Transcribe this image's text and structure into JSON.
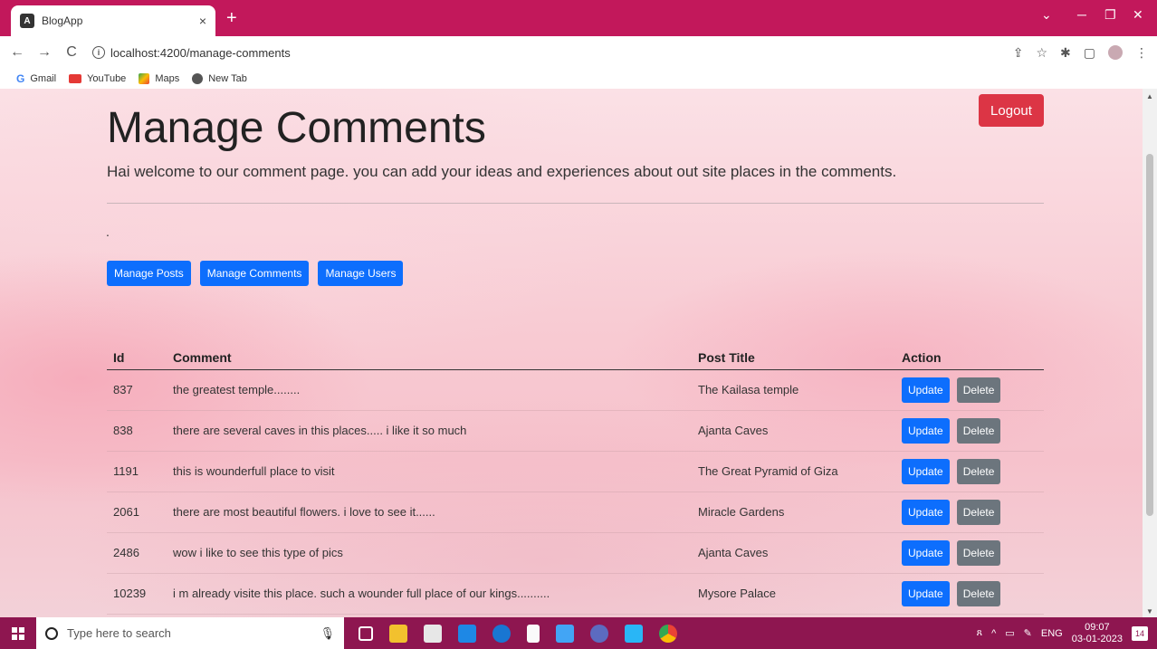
{
  "browser": {
    "tab_title": "BlogApp",
    "tab_icon_letter": "A",
    "tab_close": "×",
    "new_tab": "+",
    "url": "localhost:4200/manage-comments",
    "bookmarks": [
      "Gmail",
      "YouTube",
      "Maps",
      "New Tab"
    ],
    "bookmark_g": "G"
  },
  "page": {
    "title": "Manage Comments",
    "lead": "Hai welcome to our comment page. you can add your ideas and experiences about out site places in the comments.",
    "dot": ".",
    "logout_label": "Logout",
    "nav_buttons": [
      "Manage Posts",
      "Manage Comments",
      "Manage Users"
    ]
  },
  "table": {
    "headers": [
      "Id",
      "Comment",
      "Post Title",
      "Action"
    ],
    "update_label": "Update",
    "delete_label": "Delete",
    "rows": [
      {
        "id": "837",
        "comment": "the greatest temple........",
        "post": "The Kailasa temple"
      },
      {
        "id": "838",
        "comment": "there are several caves in this places..... i like it so much",
        "post": "Ajanta Caves"
      },
      {
        "id": "1191",
        "comment": "this is wounderfull place to visit",
        "post": "The Great Pyramid of Giza"
      },
      {
        "id": "2061",
        "comment": "there are most beautiful flowers. i love to see it......",
        "post": "Miracle Gardens"
      },
      {
        "id": "2486",
        "comment": "wow i like to see this type of pics",
        "post": "Ajanta Caves"
      },
      {
        "id": "10239",
        "comment": "i m already visite this place. such a wounder full place of our kings..........",
        "post": "Mysore Palace"
      }
    ]
  },
  "taskbar": {
    "search_placeholder": "Type here to search",
    "lang": "ENG",
    "time": "09:07",
    "date": "03-01-2023",
    "notifications": "14"
  },
  "colors": {
    "tabbar": "#c2185b",
    "taskbar": "#8e1650",
    "primary": "#0d6efd",
    "danger": "#dc3545",
    "secondary": "#6c757d"
  }
}
